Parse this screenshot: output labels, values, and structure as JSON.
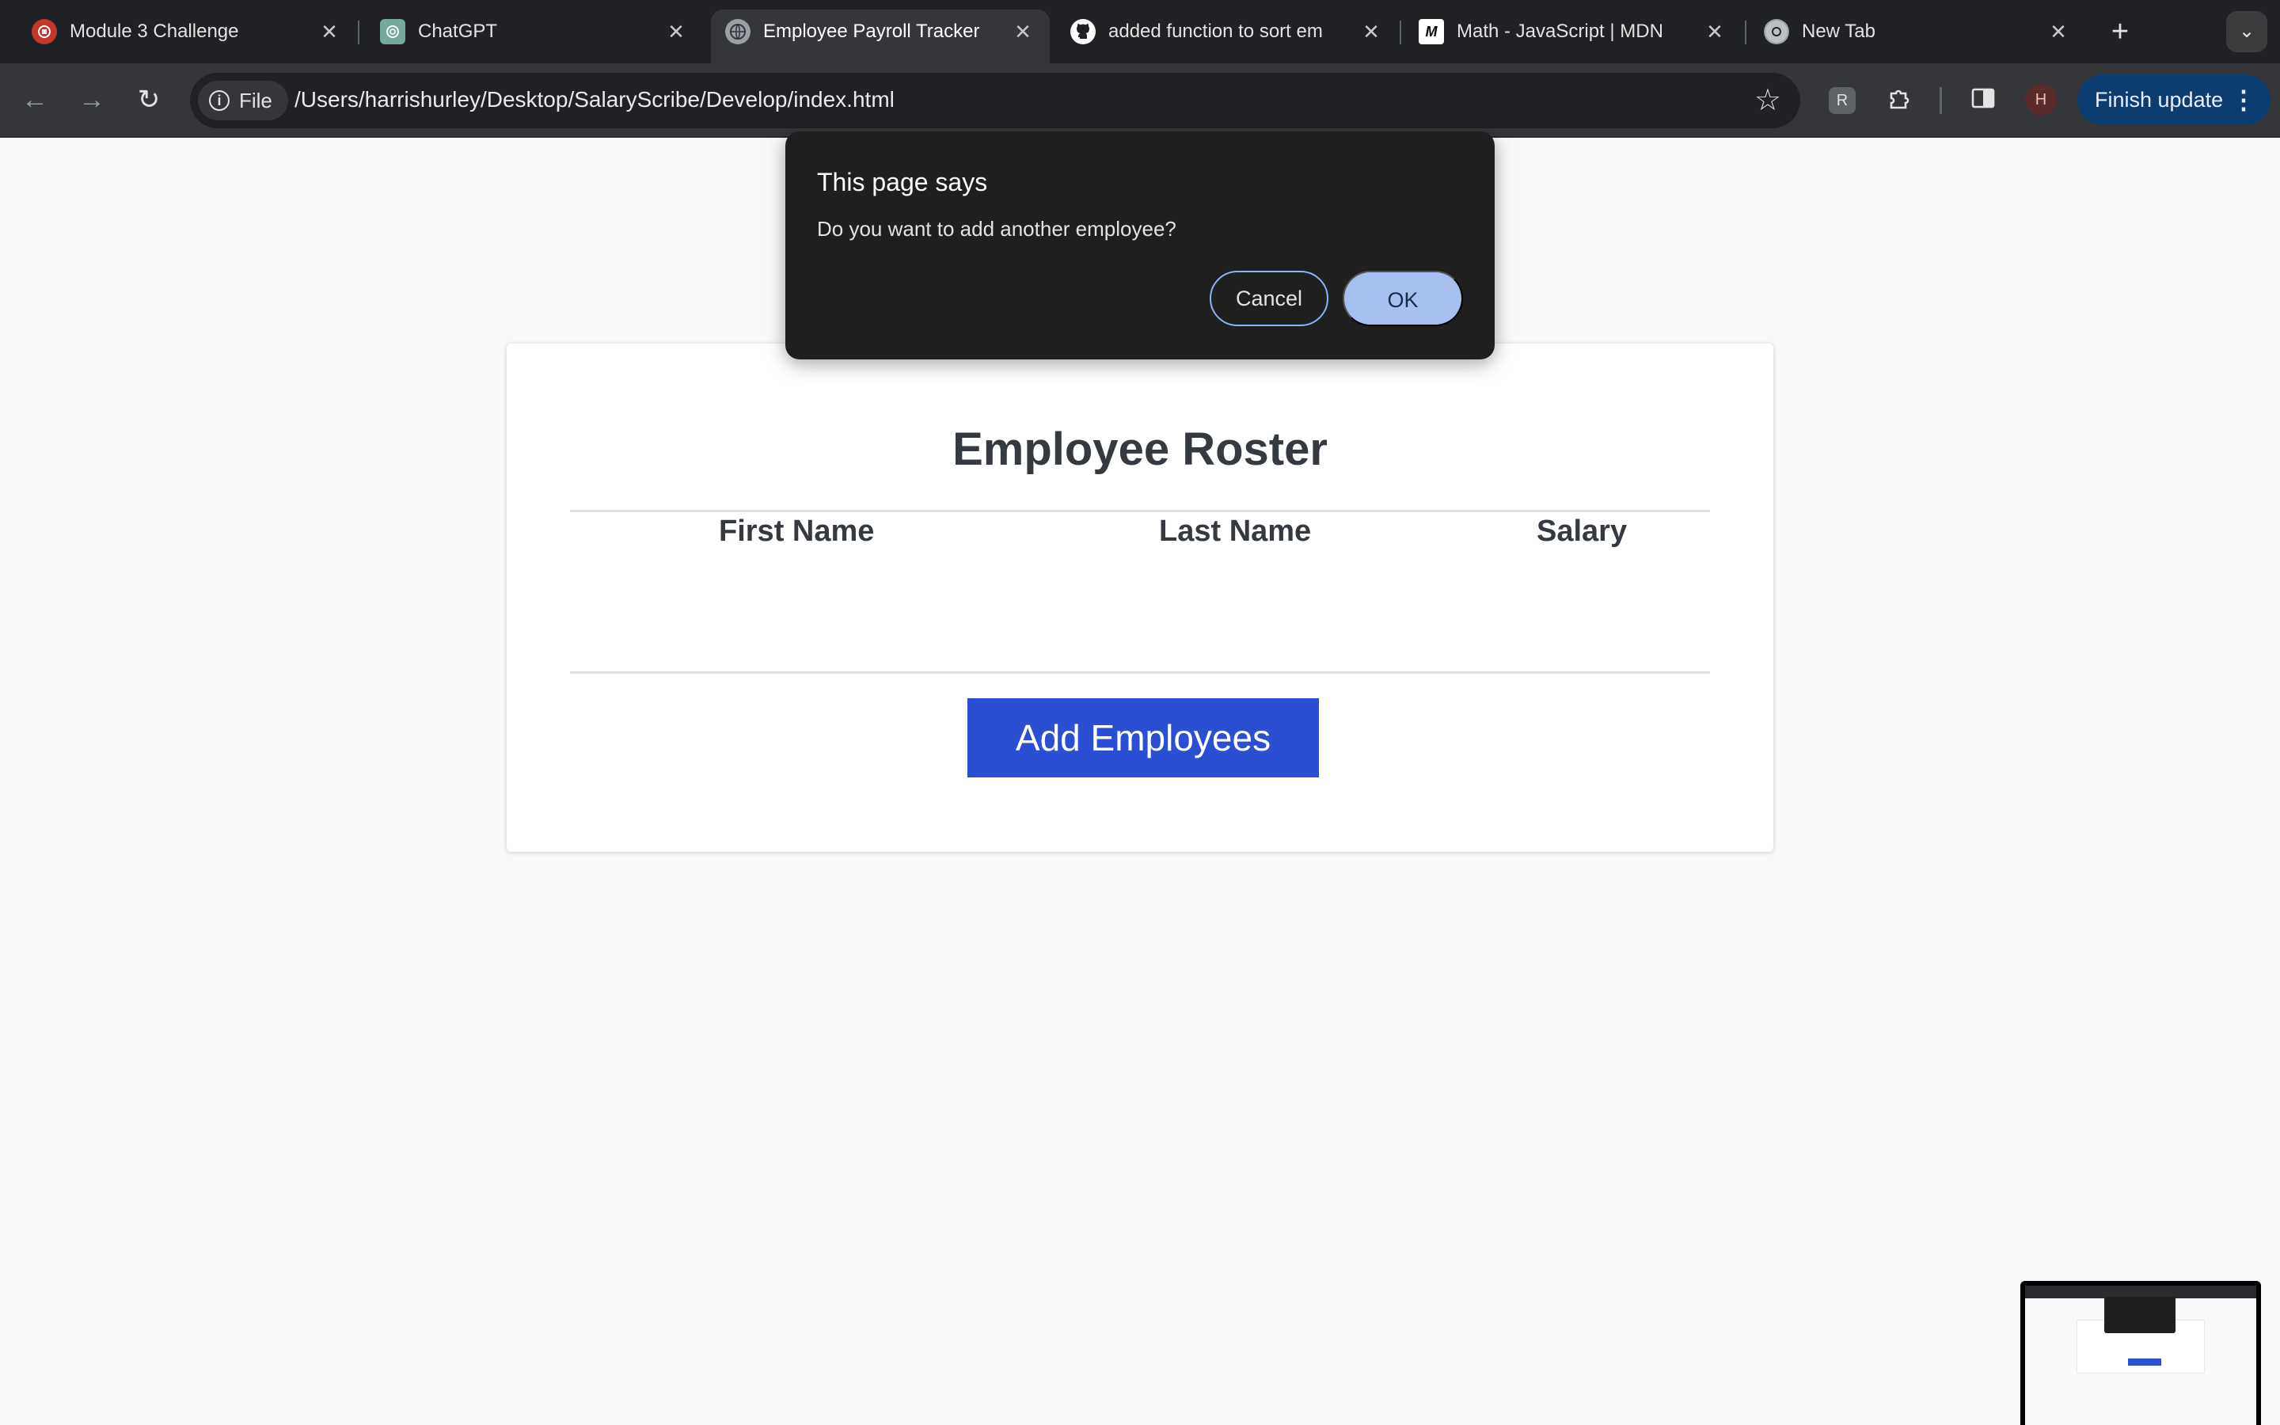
{
  "browser": {
    "tabs": [
      {
        "title": "Module 3 Challenge",
        "icon": "course-icon",
        "active": false
      },
      {
        "title": "ChatGPT",
        "icon": "chatgpt-icon",
        "active": false
      },
      {
        "title": "Employee Payroll Tracker",
        "icon": "globe-icon",
        "active": true
      },
      {
        "title": "added function to sort em",
        "icon": "github-icon",
        "active": false
      },
      {
        "title": "Math - JavaScript | MDN",
        "icon": "mdn-icon",
        "active": false
      },
      {
        "title": "New Tab",
        "icon": "chrome-icon",
        "active": false
      }
    ],
    "address": {
      "chip_label": "File",
      "url": "/Users/harrishurley/Desktop/SalaryScribe/Develop/index.html"
    },
    "profile_initial": "H",
    "update_label": "Finish update",
    "ext_label": "R"
  },
  "page": {
    "title": "Employee Roster",
    "columns": [
      "First Name",
      "Last Name",
      "Salary"
    ],
    "rows": [],
    "add_button_label": "Add Employees"
  },
  "dialog": {
    "title": "This page says",
    "message": "Do you want to add another employee?",
    "cancel_label": "Cancel",
    "ok_label": "OK"
  },
  "colors": {
    "accent_button": "#2a4fd3",
    "dialog_bg": "#1f1f1f",
    "ok_button": "#a8c0f0"
  }
}
